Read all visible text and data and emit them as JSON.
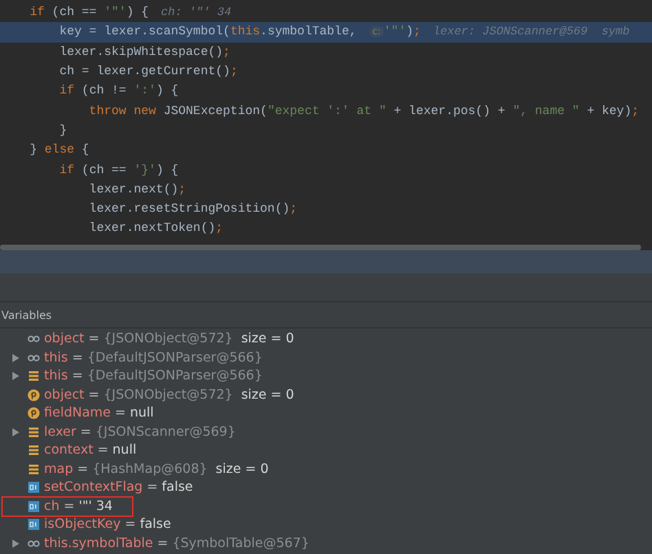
{
  "code_lines": [
    {
      "highlighted": false,
      "tokens": [
        {
          "kind": "kw",
          "text": "    if"
        },
        {
          "kind": "plain",
          "text": " (ch == "
        },
        {
          "kind": "str",
          "text": "'\"'"
        },
        {
          "kind": "plain",
          "text": ") {"
        }
      ],
      "hint": "ch: '\"' 34"
    },
    {
      "highlighted": true,
      "tokens": [
        {
          "kind": "plain",
          "text": "        key = lexer.scanSymbol("
        },
        {
          "kind": "kw",
          "text": "this"
        },
        {
          "kind": "plain",
          "text": ".symbolTable, "
        }
      ],
      "param_hint": "c:",
      "rest": [
        {
          "kind": "str",
          "text": "'\"'"
        },
        {
          "kind": "plain",
          "text": ")"
        },
        {
          "kind": "kw",
          "text": ";"
        }
      ],
      "hint": "lexer: JSONScanner@569  symb"
    },
    {
      "highlighted": false,
      "tokens": [
        {
          "kind": "plain",
          "text": "        lexer.skipWhitespace()"
        },
        {
          "kind": "kw",
          "text": ";"
        }
      ]
    },
    {
      "highlighted": false,
      "tokens": [
        {
          "kind": "plain",
          "text": "        ch = lexer.getCurrent()"
        },
        {
          "kind": "kw",
          "text": ";"
        }
      ]
    },
    {
      "highlighted": false,
      "tokens": [
        {
          "kind": "kw",
          "text": "        if"
        },
        {
          "kind": "plain",
          "text": " (ch != "
        },
        {
          "kind": "str",
          "text": "':'"
        },
        {
          "kind": "plain",
          "text": ") {"
        }
      ]
    },
    {
      "highlighted": false,
      "tokens": [
        {
          "kind": "kw",
          "text": "            throw new"
        },
        {
          "kind": "plain",
          "text": " JSONException("
        },
        {
          "kind": "str",
          "text": "\"expect ':' at \""
        },
        {
          "kind": "plain",
          "text": " + lexer.pos() + "
        },
        {
          "kind": "str",
          "text": "\", name \""
        },
        {
          "kind": "plain",
          "text": " + key)"
        },
        {
          "kind": "kw",
          "text": ";"
        }
      ]
    },
    {
      "highlighted": false,
      "tokens": [
        {
          "kind": "plain",
          "text": "        }"
        }
      ]
    },
    {
      "highlighted": false,
      "tokens": [
        {
          "kind": "plain",
          "text": "    } "
        },
        {
          "kind": "kw",
          "text": "else"
        },
        {
          "kind": "plain",
          "text": " {"
        }
      ]
    },
    {
      "highlighted": false,
      "tokens": [
        {
          "kind": "kw",
          "text": "        if"
        },
        {
          "kind": "plain",
          "text": " (ch == "
        },
        {
          "kind": "str",
          "text": "'}'"
        },
        {
          "kind": "plain",
          "text": ") {"
        }
      ]
    },
    {
      "highlighted": false,
      "tokens": [
        {
          "kind": "plain",
          "text": "            lexer.next()"
        },
        {
          "kind": "kw",
          "text": ";"
        }
      ]
    },
    {
      "highlighted": false,
      "tokens": [
        {
          "kind": "plain",
          "text": "            lexer.resetStringPosition()"
        },
        {
          "kind": "kw",
          "text": ";"
        }
      ]
    },
    {
      "highlighted": false,
      "tokens": [
        {
          "kind": "plain",
          "text": "            lexer.nextToken()"
        },
        {
          "kind": "kw",
          "text": ";"
        }
      ]
    }
  ],
  "variables": {
    "title": "Variables",
    "rows": [
      {
        "kind": "watch",
        "expandable": false,
        "name": "object",
        "separator": "=",
        "value": "{JSONObject@572}",
        "dimmed": true,
        "extra": "size = 0",
        "boxed": false
      },
      {
        "kind": "watch",
        "expandable": true,
        "name": "this",
        "separator": "=",
        "value": "{DefaultJSONParser@566}",
        "dimmed": true,
        "boxed": false
      },
      {
        "kind": "field",
        "expandable": true,
        "name": "this",
        "separator": "=",
        "value": "{DefaultJSONParser@566}",
        "dimmed": true,
        "boxed": false
      },
      {
        "kind": "param",
        "expandable": false,
        "name": "object",
        "separator": "=",
        "value": "{JSONObject@572}",
        "dimmed": true,
        "extra": "size = 0",
        "boxed": false
      },
      {
        "kind": "param",
        "expandable": false,
        "name": "fieldName",
        "separator": "=",
        "value": "null",
        "dimmed": false,
        "boxed": false
      },
      {
        "kind": "field",
        "expandable": true,
        "name": "lexer",
        "separator": "=",
        "value": "{JSONScanner@569}",
        "dimmed": true,
        "boxed": false
      },
      {
        "kind": "field",
        "expandable": false,
        "name": "context",
        "separator": "=",
        "value": "null",
        "dimmed": false,
        "boxed": false
      },
      {
        "kind": "field",
        "expandable": false,
        "name": "map",
        "separator": "=",
        "value": "{HashMap@608}",
        "dimmed": true,
        "extra": "size = 0",
        "boxed": false
      },
      {
        "kind": "local",
        "expandable": false,
        "name": "setContextFlag",
        "separator": "=",
        "value": "false",
        "dimmed": false,
        "boxed": false
      },
      {
        "kind": "local",
        "expandable": false,
        "name": "ch",
        "separator": "=",
        "value": "'\"' 34",
        "dimmed": false,
        "boxed": true
      },
      {
        "kind": "local",
        "expandable": false,
        "name": "isObjectKey",
        "separator": "=",
        "value": "false",
        "dimmed": false,
        "boxed": false
      },
      {
        "kind": "watch",
        "expandable": true,
        "name": "this.symbolTable",
        "separator": "=",
        "value": "{SymbolTable@567}",
        "dimmed": true,
        "boxed": false
      }
    ]
  }
}
